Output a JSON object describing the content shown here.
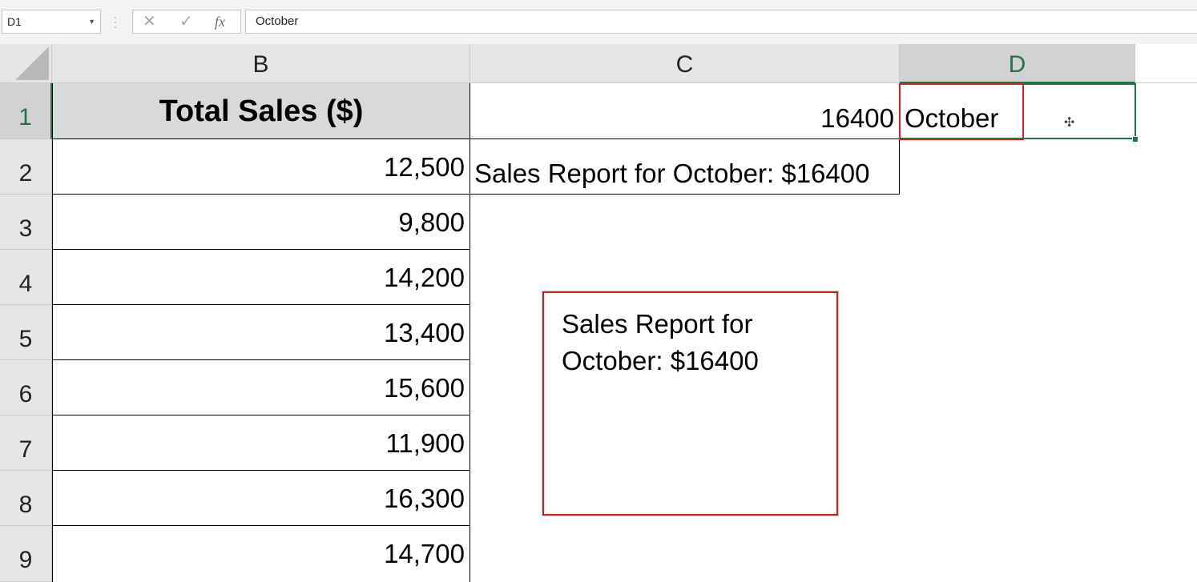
{
  "formula_bar": {
    "name_box": "D1",
    "cancel_icon": "✕",
    "enter_icon": "✓",
    "fx_label": "fx",
    "formula_value": "October"
  },
  "columns": {
    "B": "B",
    "C": "C",
    "D": "D"
  },
  "rows": [
    "1",
    "2",
    "3",
    "4",
    "5",
    "6",
    "7",
    "8",
    "9"
  ],
  "sheet": {
    "B1": "Total Sales ($)",
    "B_values": [
      "12,500",
      "9,800",
      "14,200",
      "13,400",
      "15,600",
      "11,900",
      "16,300",
      "14,700"
    ],
    "C1": "16400",
    "C2": "Sales Report for October: $16400",
    "D1": "October"
  },
  "text_box": {
    "line1": "Sales Report for",
    "line2": "October: $16400"
  },
  "colors": {
    "accent": "#217346",
    "highlight_red": "#e02020",
    "header_fill": "#d9d9d9"
  }
}
